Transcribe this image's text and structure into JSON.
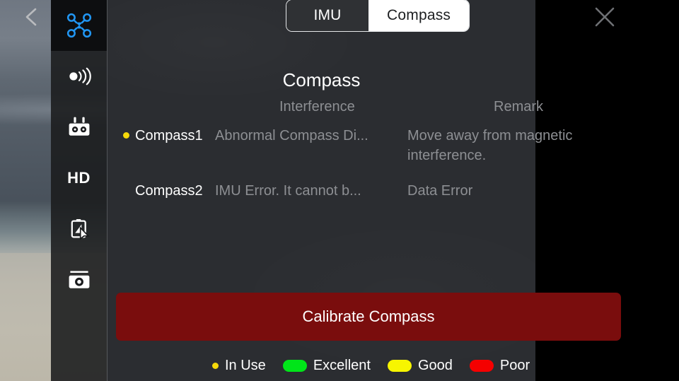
{
  "background": {
    "scene": "beach-and-overcast-sea-photo"
  },
  "sidebar": {
    "items": [
      {
        "id": "aircraft",
        "icon": "drone-icon",
        "label": "",
        "selected": true,
        "accent": "#2196f3"
      },
      {
        "id": "signal",
        "icon": "signal-waves-icon",
        "label": "",
        "selected": false
      },
      {
        "id": "remote-controller",
        "icon": "remote-controller-icon",
        "label": "",
        "selected": false
      },
      {
        "id": "image-transmission",
        "icon": "hd-text-icon",
        "label": "HD",
        "selected": false
      },
      {
        "id": "battery",
        "icon": "battery-nav-icon",
        "label": "",
        "selected": false
      },
      {
        "id": "camera",
        "icon": "camera-icon",
        "label": "",
        "selected": false
      }
    ]
  },
  "header": {
    "back_icon": "chevron-left-icon",
    "close_icon": "close-x-icon",
    "tabs": [
      {
        "id": "imu",
        "label": "IMU",
        "active": false
      },
      {
        "id": "compass",
        "label": "Compass",
        "active": true
      }
    ]
  },
  "main": {
    "title": "Compass",
    "columns": {
      "name": "",
      "interference": "Interference",
      "remark": "Remark"
    },
    "rows": [
      {
        "name": "Compass1",
        "in_use": true,
        "interference": "Abnormal Compass Di...",
        "remark": "Move away from magnetic interference."
      },
      {
        "name": "Compass2",
        "in_use": false,
        "interference": "IMU Error. It cannot b...",
        "remark": "Data Error"
      }
    ],
    "calibrate_button": {
      "label": "Calibrate Compass",
      "color": "#7a0d0d"
    }
  },
  "legend": {
    "items": [
      {
        "label": "In Use",
        "shape": "dot",
        "color": "#f5d90a"
      },
      {
        "label": "Excellent",
        "shape": "pill",
        "color": "#00e519"
      },
      {
        "label": "Good",
        "shape": "pill",
        "color": "#f7f500"
      },
      {
        "label": "Poor",
        "shape": "pill",
        "color": "#f50000"
      }
    ]
  }
}
